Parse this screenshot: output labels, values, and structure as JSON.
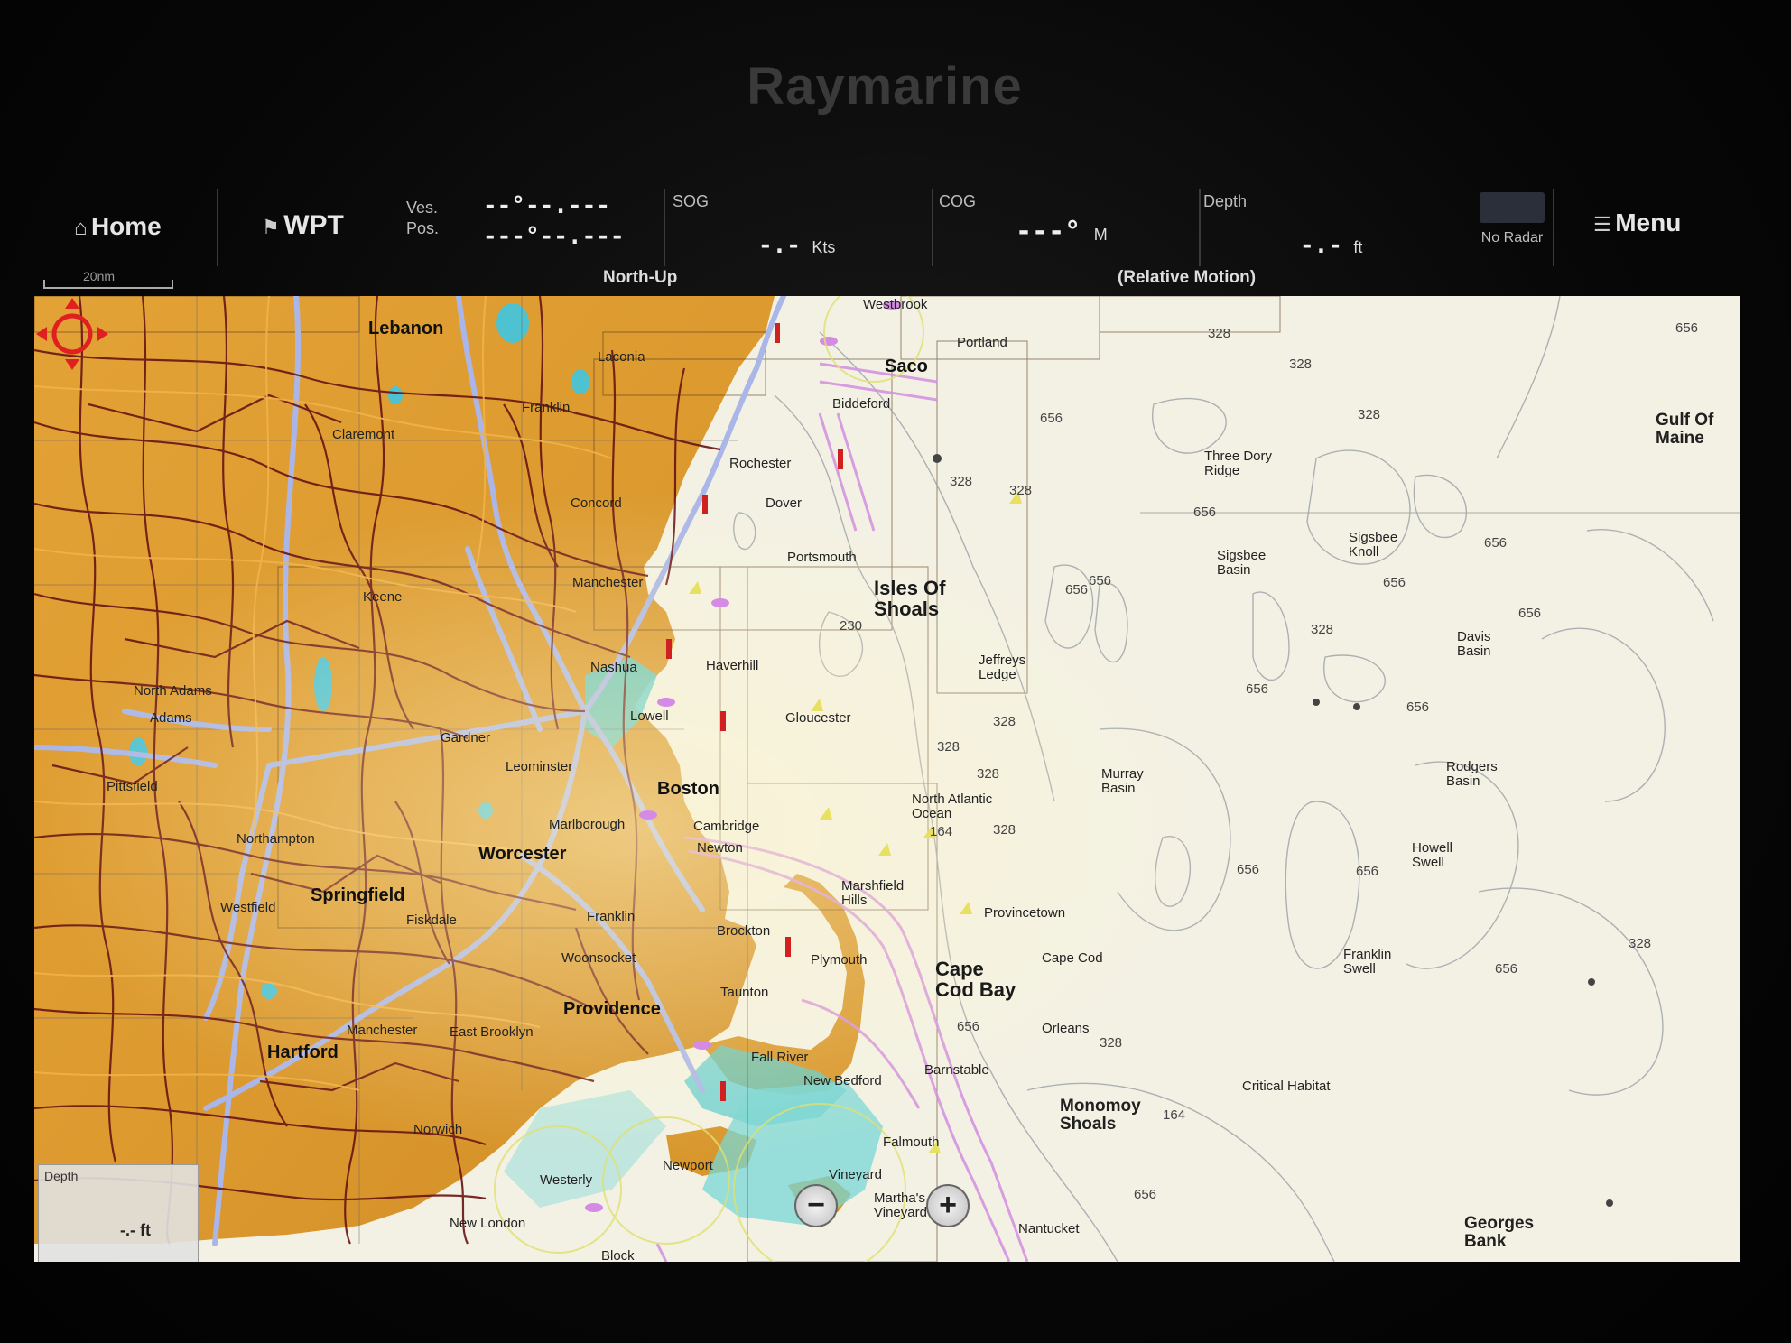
{
  "device": {
    "brand": "Raymarine"
  },
  "topbar": {
    "home_label": "Home",
    "wpt_label": "WPT",
    "ves_pos_label": "Ves.\nPos.",
    "ves_pos_line1": "--°--.---",
    "ves_pos_line2": "---°--.---",
    "sog_label": "SOG",
    "sog_value": "-.-",
    "sog_unit": "Kts",
    "cog_label": "COG",
    "cog_value": "---°",
    "cog_unit": "M",
    "depth_label": "Depth",
    "depth_value": "-.-",
    "depth_unit": "ft",
    "radar_label": "No Radar",
    "menu_label": "Menu",
    "orientation": "North-Up",
    "motion_mode": "(Relative Motion)"
  },
  "scale": {
    "label": "20nm"
  },
  "map": {
    "places": {
      "lebanon": "Lebanon",
      "saco": "Saco",
      "westbrook": "Westbrook",
      "portland": "Portland",
      "laconia": "Laconia",
      "biddeford": "Biddeford",
      "franklin": "Franklin",
      "claremont": "Claremont",
      "rochester": "Rochester",
      "concord": "Concord",
      "dover": "Dover",
      "portsmouth": "Portsmouth",
      "manchester": "Manchester",
      "keene": "Keene",
      "nashua": "Nashua",
      "haverhill": "Haverhill",
      "lowell": "Lowell",
      "gloucester": "Gloucester",
      "boston": "Boston",
      "worcester": "Worcester",
      "springfield": "Springfield",
      "providence": "Providence",
      "hartford": "Hartford",
      "north_adams": "North Adams",
      "adams": "Adams",
      "pittsfield": "Pittsfield",
      "northampton": "Northampton",
      "gardner": "Gardner",
      "leominster": "Leominster",
      "marlborough": "Marlborough",
      "cambridge": "Cambridge",
      "newton": "Newton",
      "framingham": "Franklin",
      "woonsocket": "Woonsocket",
      "taunton": "Taunton",
      "fall_river": "Fall River",
      "new_bedford": "New Bedford",
      "brockton": "Brockton",
      "plymouth": "Plymouth",
      "marshfield": "Marshfield\nHills",
      "falmouth": "Falmouth",
      "provincetown": "Provincetown",
      "cape_cod": "Cape Cod",
      "orleans": "Orleans",
      "east_brooklyn": "East Brooklyn",
      "manchester_ct": "Manchester",
      "westfield": "Westfield",
      "fiskdale": "Fiskdale",
      "new_london": "New London",
      "westerly": "Westerly",
      "newport": "Newport",
      "block": "Block",
      "vineyard": "Vineyard",
      "marthas": "Martha's\nVineyard",
      "nantucket": "Nantucket",
      "sagamore": "Barnstable",
      "northfield": "Norwich"
    },
    "features": {
      "isles_of_shoals": "Isles Of\nShoals",
      "cape_cod_bay": "Cape\nCod Bay",
      "monomoy_shoals": "Monomoy\nShoals",
      "gulf_of_maine": "Gulf Of\nMaine",
      "georges_bank": "Georges\nBank",
      "three_dory_ridge": "Three Dory\nRidge",
      "jeffreys_ledge": "Jeffreys\nLedge",
      "murray_basin": "Murray\nBasin",
      "sigsbee_knoll": "Sigsbee\nKnoll",
      "sigsbee_basin": "Sigsbee\nBasin",
      "davis_basin": "Davis\nBasin",
      "rodgers_basin": "Rodgers\nBasin",
      "howell_swell": "Howell\nSwell",
      "franklin_swell": "Franklin\nSwell",
      "critical_habitat": "Critical Habitat",
      "north_atlantic_ocean": "North Atlantic\nOcean"
    },
    "depths": [
      "328",
      "328",
      "328",
      "328",
      "656",
      "328",
      "656",
      "656",
      "656",
      "656",
      "656",
      "656",
      "328",
      "656",
      "328",
      "230",
      "328",
      "656",
      "656",
      "656",
      "328",
      "164",
      "328",
      "656",
      "656",
      "328",
      "164",
      "656",
      "328",
      "656"
    ]
  },
  "depth_box": {
    "label": "Depth",
    "value": "-.- ft"
  },
  "zoom": {
    "out_symbol": "−",
    "in_symbol": "+"
  },
  "colors": {
    "land": "#d99a2e",
    "water_shallow": "#58c8c8",
    "water_deep": "#f3f1e4",
    "roads": "#6a1414"
  }
}
